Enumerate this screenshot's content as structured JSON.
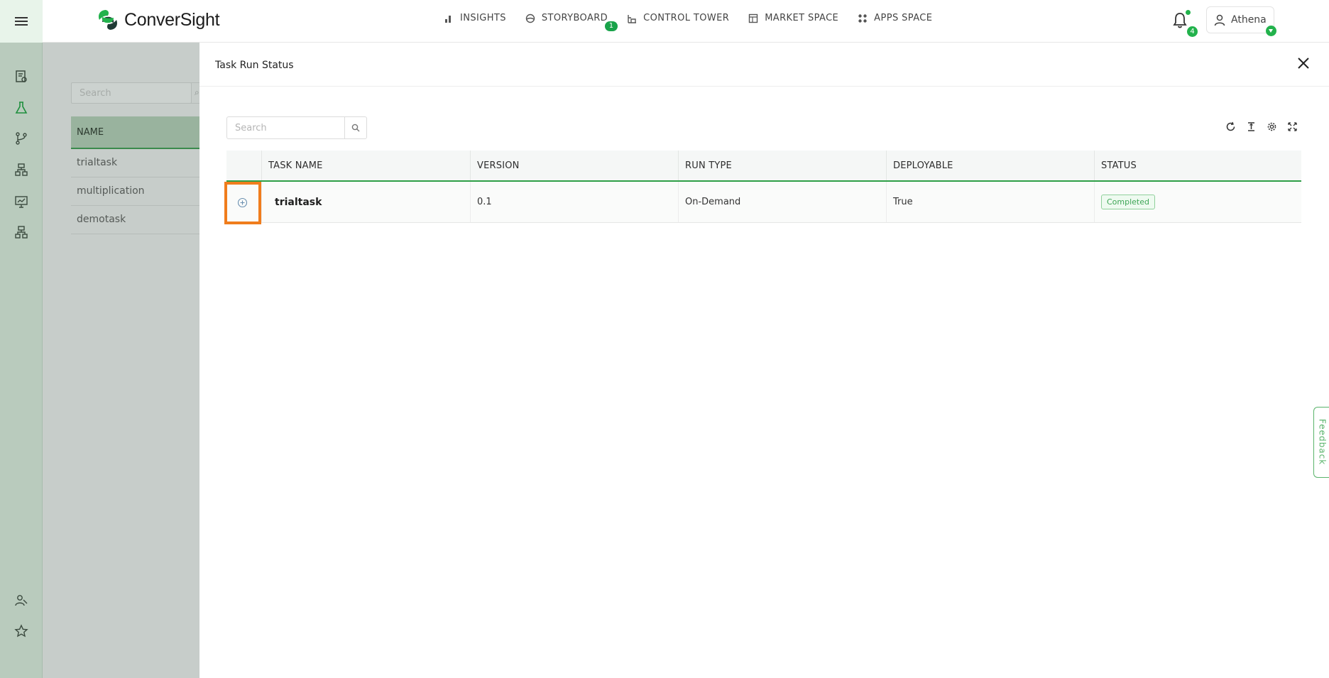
{
  "nav": {
    "brand": "ConverSight",
    "links": [
      {
        "label": "INSIGHTS",
        "icon": "bar-chart-icon"
      },
      {
        "label": "STORYBOARD",
        "icon": "storyboard-icon",
        "badge": "1"
      },
      {
        "label": "CONTROL TOWER",
        "icon": "tower-icon"
      },
      {
        "label": "MARKET SPACE",
        "icon": "market-icon"
      },
      {
        "label": "APPS SPACE",
        "icon": "apps-grid-icon"
      }
    ],
    "notifications_count": "4",
    "user_name": "Athena",
    "accent": "#22b24c"
  },
  "background": {
    "search_placeholder": "Search",
    "table_header": "NAME",
    "rows": [
      "trialtask",
      "multiplication",
      "demotask"
    ]
  },
  "drawer": {
    "title": "Task Run Status",
    "search_placeholder": "Search",
    "columns": [
      "TASK NAME",
      "VERSION",
      "RUN TYPE",
      "DEPLOYABLE",
      "STATUS"
    ],
    "rows": [
      {
        "task_name": "trialtask",
        "version": "0.1",
        "run_type": "On-Demand",
        "deployable": "True",
        "status": "Completed"
      }
    ]
  },
  "feedback_label": "Feedback"
}
